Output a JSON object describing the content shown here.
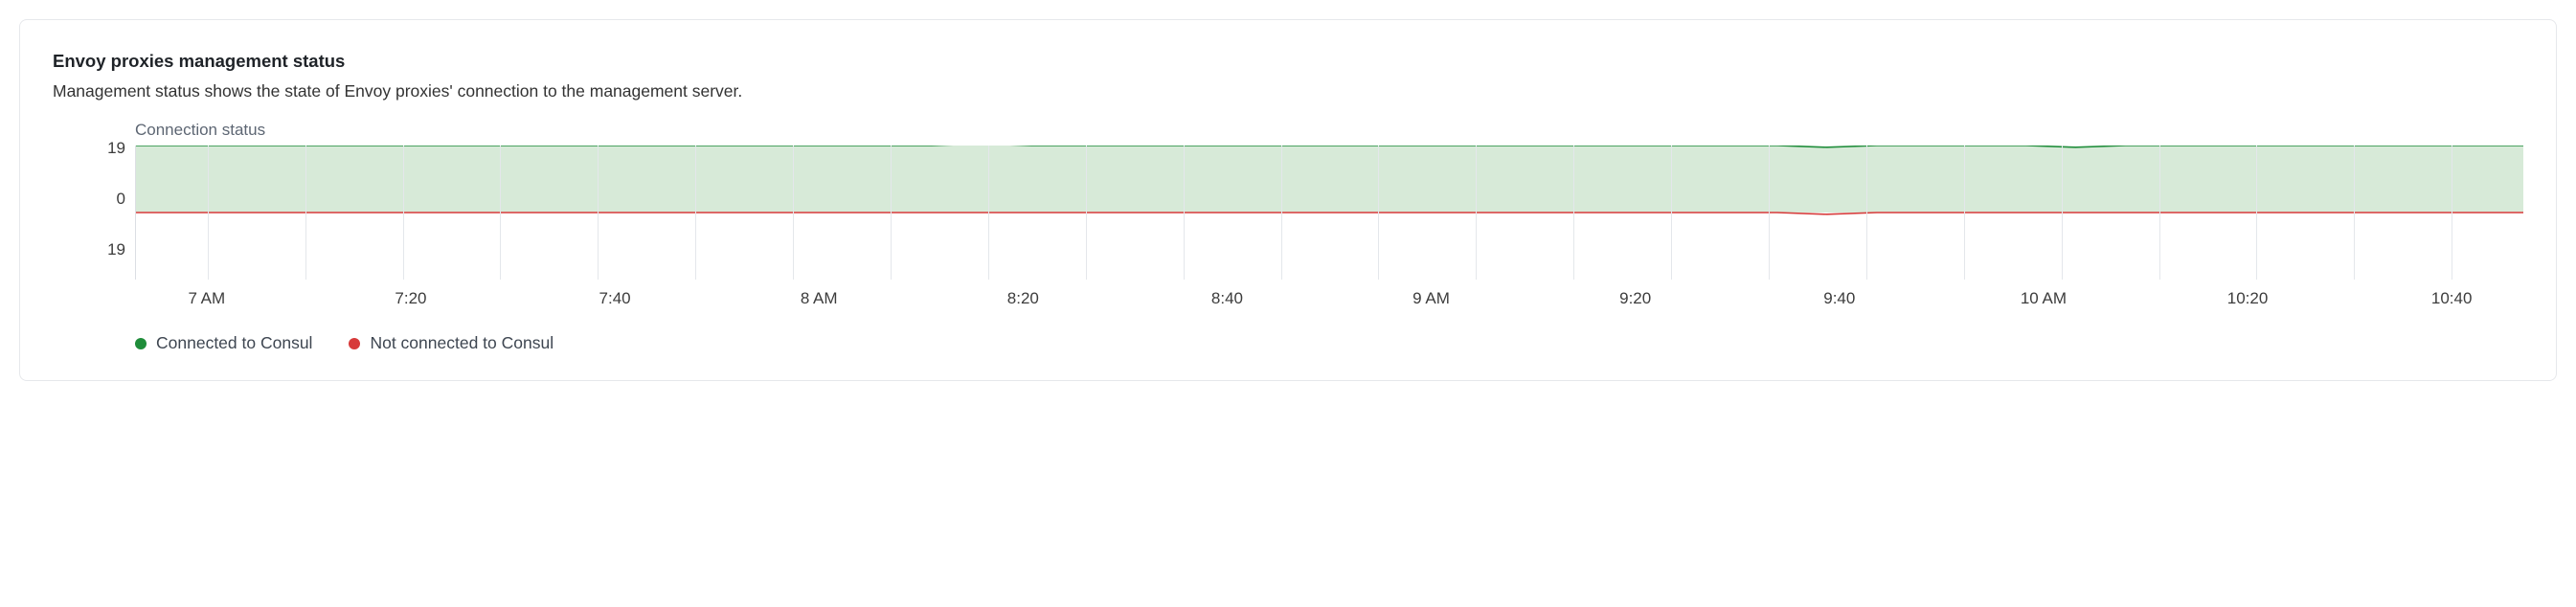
{
  "title": "Envoy proxies management status",
  "description": "Management status shows the state of Envoy proxies' connection to the management server.",
  "chart_data": {
    "type": "area",
    "title": "Connection status",
    "xlabel": "",
    "ylabel": "",
    "ylim": [
      -19,
      19
    ],
    "y_ticks": [
      19,
      0,
      19
    ],
    "x_ticks": [
      "7 AM",
      "7:20",
      "7:40",
      "8 AM",
      "8:20",
      "8:40",
      "9 AM",
      "9:20",
      "9:40",
      "10 AM",
      "10:20",
      "10:40"
    ],
    "series": [
      {
        "name": "Connected to Consul",
        "color": "#1f8d3a",
        "fill": "#d7ead8",
        "values": [
          19,
          19,
          19,
          19,
          19,
          19,
          19,
          19,
          19,
          19,
          19,
          19,
          19,
          19,
          19,
          19,
          19,
          19.5,
          19,
          19,
          19,
          19,
          19,
          19,
          19,
          19,
          19,
          19,
          19,
          19,
          19,
          19,
          19,
          19,
          18.5,
          19,
          19,
          19,
          19,
          18.5,
          19,
          19,
          19,
          19,
          19,
          19,
          19,
          19,
          19
        ]
      },
      {
        "name": "Not connected to Consul",
        "color": "#d73a3a",
        "fill": "none",
        "values": [
          0,
          0,
          0,
          0,
          0,
          0,
          0,
          0,
          0,
          0,
          0,
          0,
          0,
          0,
          0,
          0,
          0,
          0,
          0,
          0,
          0,
          0,
          0,
          0,
          0,
          0,
          0,
          0,
          0,
          0,
          0,
          0,
          0,
          0,
          -0.5,
          0,
          0,
          0,
          0,
          0,
          0,
          0,
          0,
          0,
          0,
          0,
          0,
          0,
          0
        ]
      }
    ]
  },
  "legend": [
    {
      "label": "Connected to Consul",
      "color": "#1f8d3a"
    },
    {
      "label": "Not connected to Consul",
      "color": "#d73a3a"
    }
  ]
}
